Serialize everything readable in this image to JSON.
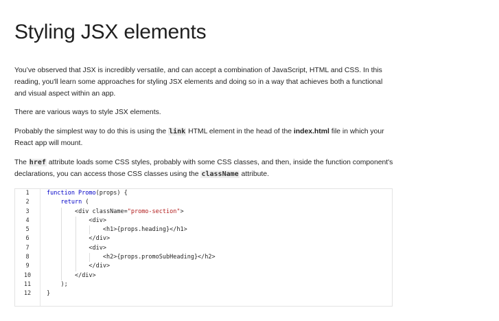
{
  "title": "Styling JSX elements",
  "paragraph1": "You’ve observed that JSX is incredibly versatile, and can accept a combination of JavaScript, HTML and CSS.  In this reading, you'll learn some approaches for styling JSX elements and doing so in a way that achieves both a functional and visual aspect within an app.",
  "paragraph2": "There are various ways to style JSX elements.",
  "paragraph3": {
    "before": "Probably the simplest way to do this is using the ",
    "code": "link",
    "middle": " HTML element in the head of the ",
    "bold": "index.html",
    "after": " file in which your React app will mount."
  },
  "paragraph4": {
    "before": "The ",
    "code1": "href",
    "middle": " attribute loads some CSS styles, probably with some CSS classes, and then, inside the function component's declarations, you can access those CSS classes using the ",
    "code2": "className",
    "after": " attribute."
  },
  "code_block": {
    "line_numbers": [
      "1",
      "2",
      "3",
      "4",
      "5",
      "6",
      "7",
      "8",
      "9",
      "10",
      "11",
      "12"
    ],
    "lines": [
      {
        "indent": "",
        "kw": "function Promo",
        "text": "(props) {",
        "str": ""
      },
      {
        "indent": "    ",
        "kw": "return",
        "text": " (",
        "str": ""
      },
      {
        "indent": "        ",
        "kw": "",
        "text": "<div className=",
        "str": "\"promo-section\"",
        "tail": ">"
      },
      {
        "indent": "            ",
        "kw": "",
        "text": "<div>",
        "str": ""
      },
      {
        "indent": "                ",
        "kw": "",
        "text": "<h1>{props.heading}</h1>",
        "str": ""
      },
      {
        "indent": "            ",
        "kw": "",
        "text": "</div>",
        "str": ""
      },
      {
        "indent": "            ",
        "kw": "",
        "text": "<div>",
        "str": ""
      },
      {
        "indent": "                ",
        "kw": "",
        "text": "<h2>{props.promoSubHeading}</h2>",
        "str": ""
      },
      {
        "indent": "            ",
        "kw": "",
        "text": "</div>",
        "str": ""
      },
      {
        "indent": "        ",
        "kw": "",
        "text": "</div>",
        "str": ""
      },
      {
        "indent": "    ",
        "kw": "",
        "text": ");",
        "str": ""
      },
      {
        "indent": "",
        "kw": "",
        "text": "}",
        "str": ""
      }
    ]
  }
}
